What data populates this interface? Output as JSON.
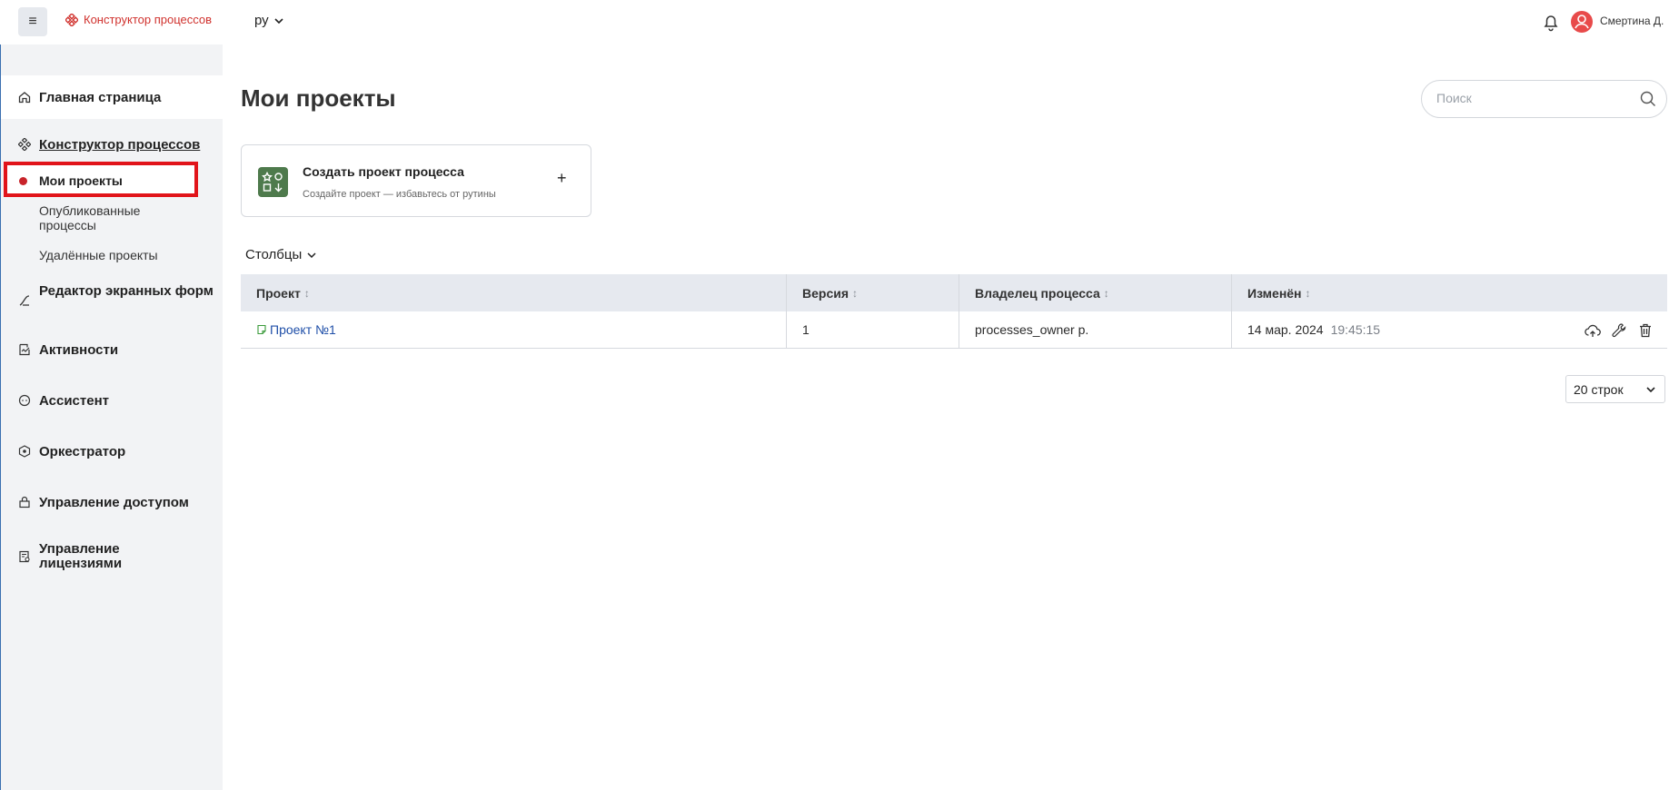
{
  "topbar": {
    "menu_icon": "hamburger-icon",
    "brand": "Конструктор процессов",
    "lang": "ру",
    "user": "Смертина Д.",
    "accent": "#d0312d"
  },
  "sidebar": {
    "items": [
      {
        "label": "Главная страница",
        "icon": "home-icon"
      },
      {
        "label": "Конструктор процессов",
        "icon": "process-icon"
      },
      {
        "label": "Редактор экранных форм",
        "icon": "form-editor-icon"
      },
      {
        "label": "Активности",
        "icon": "activity-icon"
      },
      {
        "label": "Ассистент",
        "icon": "assistant-icon"
      },
      {
        "label": "Оркестратор",
        "icon": "orchestrator-icon"
      },
      {
        "label": "Управление доступом",
        "icon": "access-icon"
      },
      {
        "label": "Управление лицензиями",
        "icon": "license-icon"
      }
    ],
    "sub_items": [
      {
        "label": "Мои проекты"
      },
      {
        "label": "Опубликованные процессы"
      },
      {
        "label": "Удалённые проекты"
      }
    ]
  },
  "main": {
    "title": "Мои проекты",
    "search_placeholder": "Поиск",
    "create": {
      "title": "Создать проект процесса",
      "subtitle": "Создайте проект — избавьтесь от рутины",
      "plus": "+"
    },
    "columns_btn": "Столбцы",
    "table": {
      "headers": [
        "Проект",
        "Версия",
        "Владелец процесса",
        "Изменён"
      ],
      "rows": [
        {
          "project": "Проект №1",
          "version": "1",
          "owner": "processes_owner p.",
          "date": "14 мар. 2024",
          "time": "19:45:15"
        }
      ]
    },
    "rows_per_page": "20 строк"
  }
}
